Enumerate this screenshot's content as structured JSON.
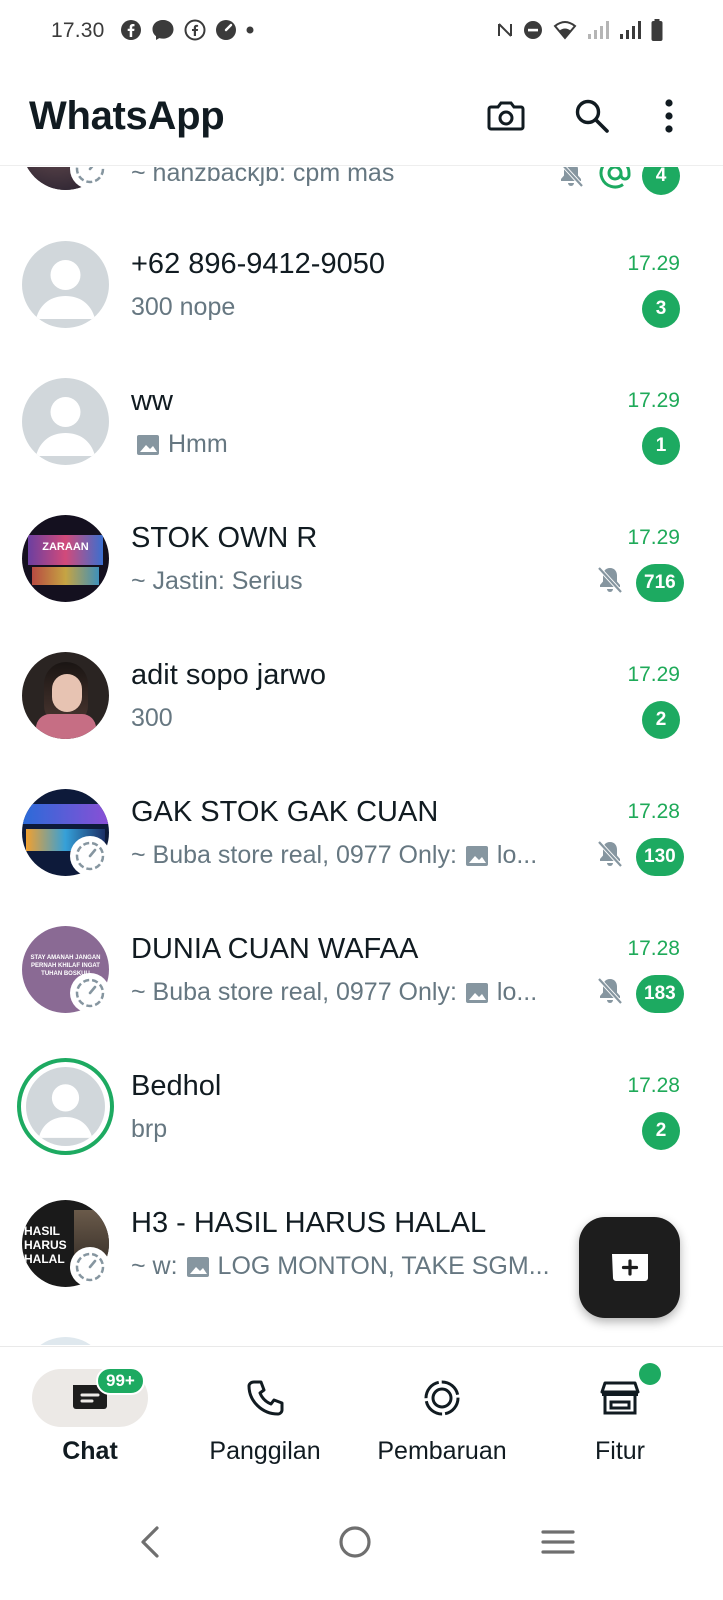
{
  "status_bar": {
    "time": "17.30"
  },
  "header": {
    "title": "WhatsApp",
    "camera_icon": "camera-icon",
    "search_icon": "search-icon",
    "menu_icon": "more-vert-icon"
  },
  "chats": [
    {
      "name": "",
      "message": "~ hanzbackjb: cpm mas",
      "time": "",
      "unread": "4",
      "muted": true,
      "mention": true
    },
    {
      "name": "+62 896-9412-9050",
      "message": "300 nope",
      "time": "17.29",
      "unread": "3",
      "muted": false
    },
    {
      "name": "ww",
      "message": "Hmm",
      "time": "17.29",
      "unread": "1",
      "muted": false,
      "image": true
    },
    {
      "name": "STOK OWN R",
      "message": "~ Jastin: Serius",
      "time": "17.29",
      "unread": "716",
      "muted": true
    },
    {
      "name": "adit sopo jarwo",
      "message": "300",
      "time": "17.29",
      "unread": "2",
      "muted": false
    },
    {
      "name": "GAK STOK GAK CUAN",
      "message_prefix": "~ Buba store real, 0977 Only:",
      "message": "lo...",
      "time": "17.28",
      "unread": "130",
      "muted": true,
      "image": true
    },
    {
      "name": "DUNIA CUAN WAFAA",
      "message_prefix": "~ Buba store real, 0977 Only:",
      "message": "lo...",
      "time": "17.28",
      "unread": "183",
      "muted": true,
      "image": true
    },
    {
      "name": "Bedhol",
      "message": "brp",
      "time": "17.28",
      "unread": "2",
      "muted": false
    },
    {
      "name": "H3 - HASIL HARUS HALAL",
      "message_prefix": "~ w:",
      "message": "LOG MONTON, TAKE SGM...",
      "time": "",
      "unread": "",
      "muted": false,
      "image": true
    }
  ],
  "avatar_texts": {
    "stok_own": "ZARAAN",
    "gak_stok": "",
    "dunia_cuan": "STAY AMANAH JANGAN PERNAH KHILAF INGAT TUHAN BOSKUU",
    "h3": "HASIL HARUS HALAL"
  },
  "nav": {
    "chat_label": "Chat",
    "chat_badge": "99+",
    "calls_label": "Panggilan",
    "updates_label": "Pembaruan",
    "tools_label": "Fitur"
  },
  "colors": {
    "accent": "#1daa61",
    "time_green": "#1faa59",
    "muted_text": "#667781"
  }
}
